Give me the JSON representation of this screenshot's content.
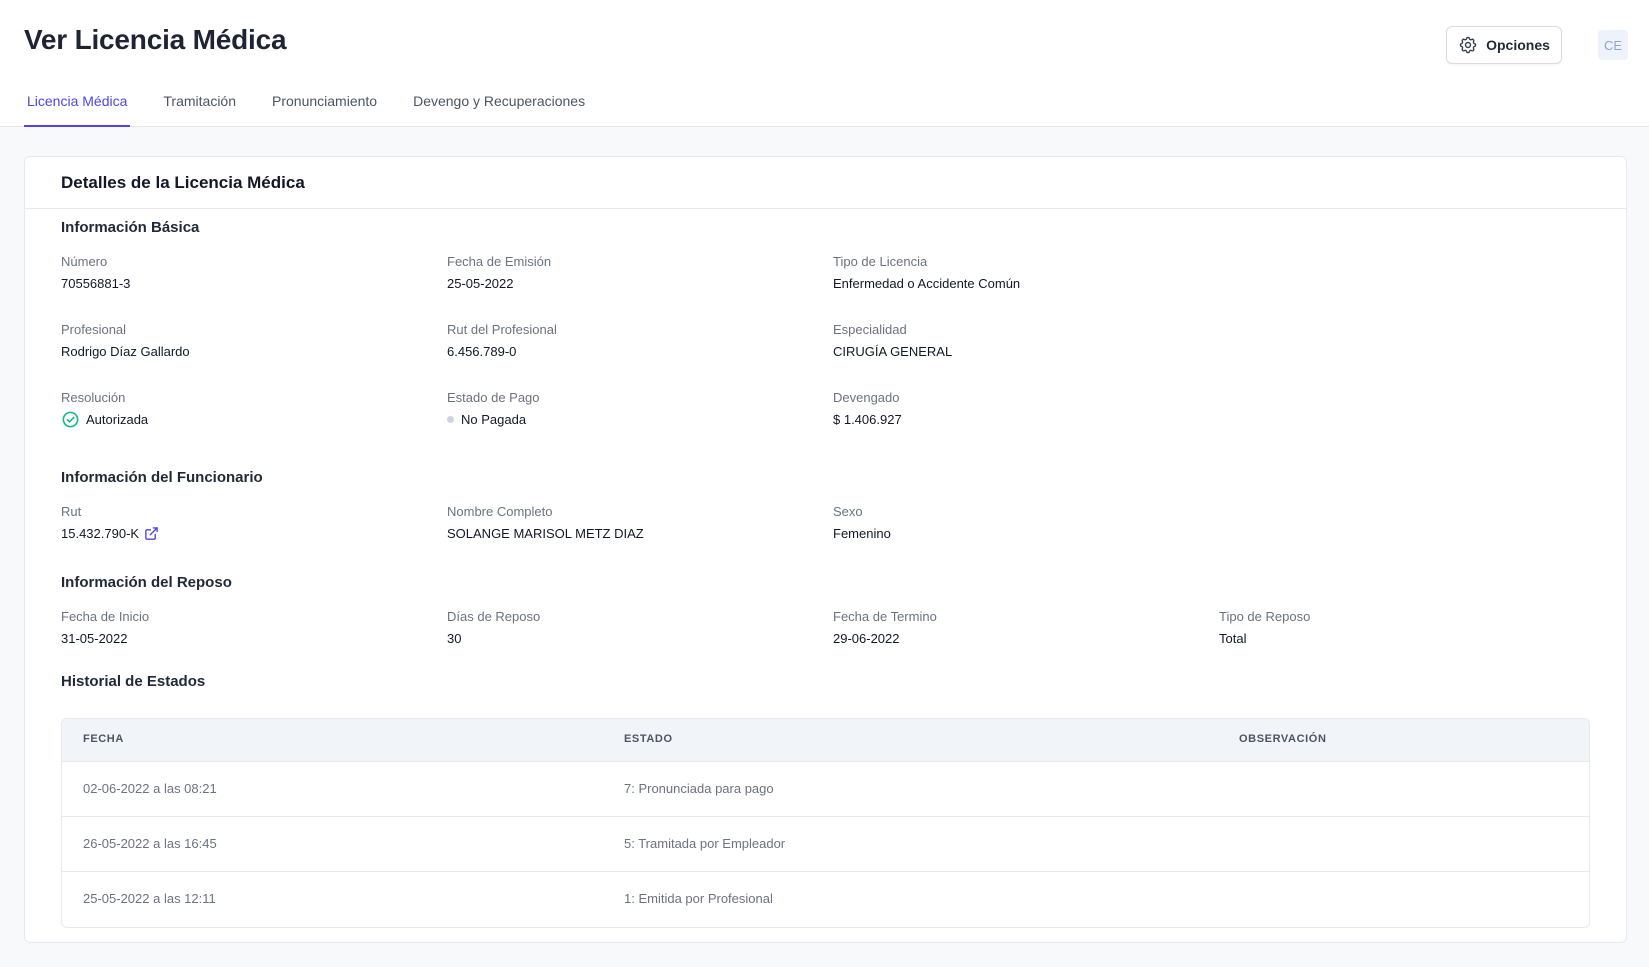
{
  "header": {
    "title": "Ver Licencia Médica",
    "options_label": "Opciones",
    "avatar_initials": "CE"
  },
  "tabs": [
    {
      "label": "Licencia Médica",
      "active": true
    },
    {
      "label": "Tramitación",
      "active": false
    },
    {
      "label": "Pronunciamiento",
      "active": false
    },
    {
      "label": "Devengo y Recuperaciones",
      "active": false
    }
  ],
  "card": {
    "title": "Detalles de la Licencia Médica",
    "basic": {
      "title": "Información Básica",
      "numero": {
        "label": "Número",
        "value": "70556881-3"
      },
      "fecha_emision": {
        "label": "Fecha de Emisión",
        "value": "25-05-2022"
      },
      "tipo_licencia": {
        "label": "Tipo de Licencia",
        "value": "Enfermedad o Accidente Común"
      },
      "profesional": {
        "label": "Profesional",
        "value": "Rodrigo Díaz Gallardo"
      },
      "rut_profesional": {
        "label": "Rut del Profesional",
        "value": "6.456.789-0"
      },
      "especialidad": {
        "label": "Especialidad",
        "value": "CIRUGÍA GENERAL"
      },
      "resolucion": {
        "label": "Resolución",
        "value": "Autorizada"
      },
      "estado_pago": {
        "label": "Estado de Pago",
        "value": "No Pagada"
      },
      "devengado": {
        "label": "Devengado",
        "value": "$ 1.406.927"
      }
    },
    "funcionario": {
      "title": "Información del Funcionario",
      "rut": {
        "label": "Rut",
        "value": "15.432.790-K"
      },
      "nombre": {
        "label": "Nombre Completo",
        "value": "SOLANGE MARISOL METZ DIAZ"
      },
      "sexo": {
        "label": "Sexo",
        "value": "Femenino"
      }
    },
    "reposo": {
      "title": "Información del Reposo",
      "fecha_inicio": {
        "label": "Fecha de Inicio",
        "value": "31-05-2022"
      },
      "dias": {
        "label": "Días de Reposo",
        "value": "30"
      },
      "fecha_termino": {
        "label": "Fecha de Termino",
        "value": "29-06-2022"
      },
      "tipo": {
        "label": "Tipo de Reposo",
        "value": "Total"
      }
    },
    "historial": {
      "title": "Historial de Estados",
      "columns": [
        "FECHA",
        "ESTADO",
        "OBSERVACIÓN"
      ],
      "rows": [
        {
          "fecha": "02-06-2022 a las 08:21",
          "estado": "7: Pronunciada para pago",
          "observacion": ""
        },
        {
          "fecha": "26-05-2022 a las 16:45",
          "estado": "5: Tramitada por Empleador",
          "observacion": ""
        },
        {
          "fecha": "25-05-2022 a las 12:11",
          "estado": "1: Emitida por Profesional",
          "observacion": ""
        }
      ]
    }
  },
  "colors": {
    "accent": "#4f46e5",
    "success": "#10b981",
    "muted_dot": "#cbd5e1"
  },
  "icons": {
    "options": "gear-icon",
    "resolution": "check-circle-icon",
    "rut_link": "external-link-icon"
  }
}
